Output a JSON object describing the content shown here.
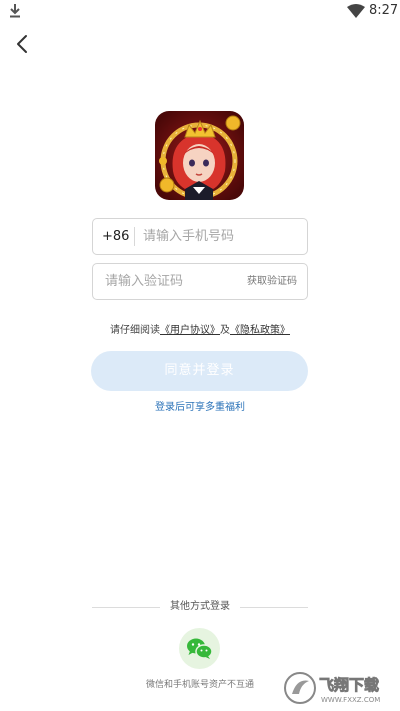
{
  "status_bar": {
    "time": "8:27",
    "download_icon": "download-icon",
    "wifi_icon": "wifi-icon"
  },
  "nav": {
    "back_icon": "back-arrow-icon"
  },
  "app_icon": "app-icon",
  "phone": {
    "prefix": "+86",
    "placeholder": "请输入手机号码",
    "value": ""
  },
  "code": {
    "placeholder": "请输入验证码",
    "value": "",
    "get_code_label": "获取验证码"
  },
  "agreement": {
    "prefix": "请仔细阅读",
    "user_agreement": "《用户协议》",
    "and": "及",
    "privacy_policy": "《隐私政策》"
  },
  "login_button_label": "同意并登录",
  "benefits_link": "登录后可享多重福利",
  "other_login": {
    "title": "其他方式登录",
    "wechat_icon": "wechat-icon",
    "note": "微信和手机账号资产不互通"
  },
  "watermark": {
    "text": "飞翔下载",
    "url_text": "WWW.FXXZ.COM"
  },
  "colors": {
    "button_bg": "#dceaf8",
    "link": "#2a72b8",
    "wechat_green": "#36b83a"
  }
}
